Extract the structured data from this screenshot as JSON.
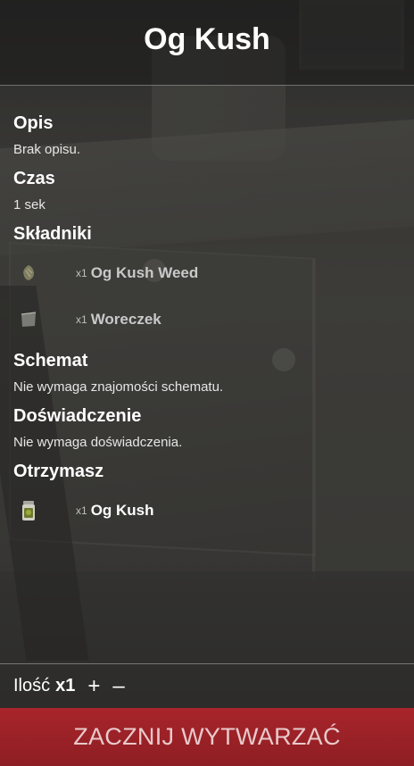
{
  "title": "Og Kush",
  "description": {
    "heading": "Opis",
    "text": "Brak opisu."
  },
  "time": {
    "heading": "Czas",
    "text": "1 sek"
  },
  "ingredients": {
    "heading": "Składniki",
    "items": [
      {
        "qty": "x1",
        "name": "Og Kush Weed",
        "icon": "weed-bud-icon"
      },
      {
        "qty": "x1",
        "name": "Woreczek",
        "icon": "bag-icon"
      }
    ]
  },
  "blueprint": {
    "heading": "Schemat",
    "text": "Nie wymaga znajomości schematu."
  },
  "experience": {
    "heading": "Doświadczenie",
    "text": "Nie wymaga doświadczenia."
  },
  "result": {
    "heading": "Otrzymasz",
    "items": [
      {
        "qty": "x1",
        "name": "Og Kush",
        "icon": "jar-icon"
      }
    ]
  },
  "quantity": {
    "label": "Ilość",
    "value": "x1",
    "plus": "+",
    "minus": "–"
  },
  "start_button": {
    "label": "ZACZNIJ WYTWARZAĆ",
    "color": "#9b2228"
  }
}
